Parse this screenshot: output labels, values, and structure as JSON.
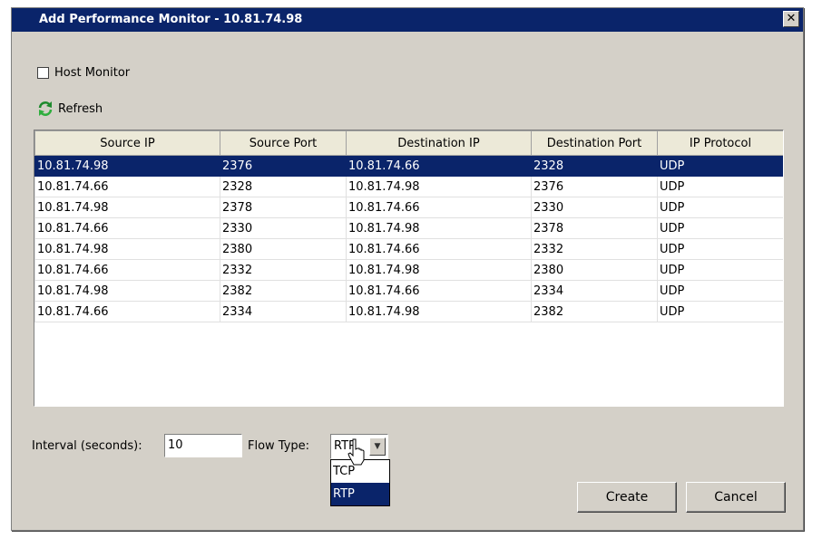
{
  "window": {
    "title": "Add Performance Monitor - 10.81.74.98",
    "close_glyph": "✕"
  },
  "host_monitor": {
    "label": "Host Monitor",
    "checked": false
  },
  "refresh": {
    "label": "Refresh",
    "icon": "refresh-icon"
  },
  "table": {
    "columns": [
      "Source IP",
      "Source Port",
      "Destination IP",
      "Destination Port",
      "IP Protocol"
    ],
    "rows": [
      [
        "10.81.74.98",
        "2376",
        "10.81.74.66",
        "2328",
        "UDP"
      ],
      [
        "10.81.74.66",
        "2328",
        "10.81.74.98",
        "2376",
        "UDP"
      ],
      [
        "10.81.74.98",
        "2378",
        "10.81.74.66",
        "2330",
        "UDP"
      ],
      [
        "10.81.74.66",
        "2330",
        "10.81.74.98",
        "2378",
        "UDP"
      ],
      [
        "10.81.74.98",
        "2380",
        "10.81.74.66",
        "2332",
        "UDP"
      ],
      [
        "10.81.74.66",
        "2332",
        "10.81.74.98",
        "2380",
        "UDP"
      ],
      [
        "10.81.74.98",
        "2382",
        "10.81.74.66",
        "2334",
        "UDP"
      ],
      [
        "10.81.74.66",
        "2334",
        "10.81.74.98",
        "2382",
        "UDP"
      ]
    ],
    "selected_row": 0
  },
  "interval": {
    "label": "Interval (seconds):",
    "value": "10"
  },
  "flow_type": {
    "label": "Flow Type:",
    "selected": "RTP",
    "options": [
      "TCP",
      "RTP"
    ]
  },
  "buttons": {
    "create": "Create",
    "cancel": "Cancel"
  },
  "colors": {
    "title_bar": "#0a246a",
    "selection": "#0a246a",
    "window_bg": "#d4d0c8"
  }
}
